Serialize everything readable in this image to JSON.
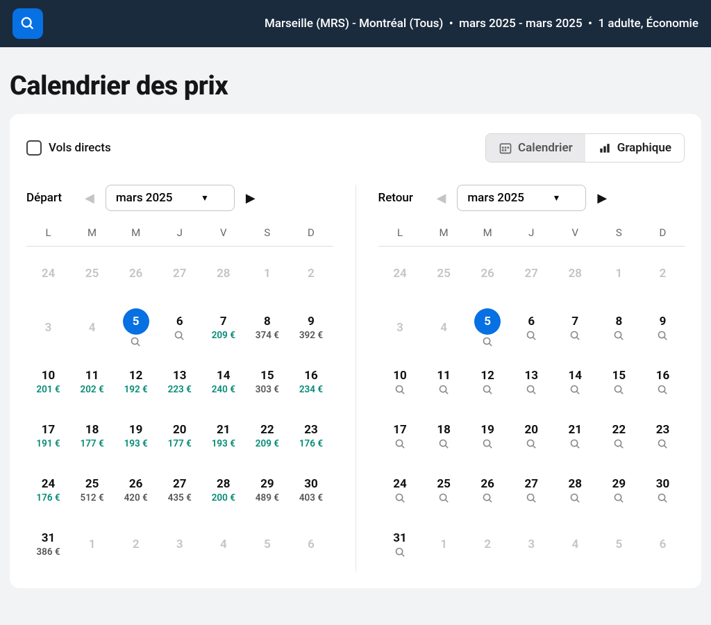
{
  "topbar": {
    "route": "Marseille (MRS) - Montréal (Tous)",
    "dates": "mars 2025 - mars 2025",
    "pax": "1 adulte, Économie"
  },
  "page_title": "Calendrier des prix",
  "direct_flights_label": "Vols directs",
  "view_toggle": {
    "calendar": "Calendrier",
    "chart": "Graphique"
  },
  "dow": [
    "L",
    "M",
    "M",
    "J",
    "V",
    "S",
    "D"
  ],
  "depart": {
    "label": "Départ",
    "month": "mars 2025",
    "cells": [
      {
        "d": "24",
        "dis": true
      },
      {
        "d": "25",
        "dis": true
      },
      {
        "d": "26",
        "dis": true
      },
      {
        "d": "27",
        "dis": true
      },
      {
        "d": "28",
        "dis": true
      },
      {
        "d": "1",
        "dis": true
      },
      {
        "d": "2",
        "dis": true
      },
      {
        "d": "3",
        "dis": true
      },
      {
        "d": "4",
        "dis": true
      },
      {
        "d": "5",
        "sel": true,
        "srch": true
      },
      {
        "d": "6",
        "srch": true
      },
      {
        "d": "7",
        "p": "209 €",
        "pl": true
      },
      {
        "d": "8",
        "p": "374 €"
      },
      {
        "d": "9",
        "p": "392 €"
      },
      {
        "d": "10",
        "p": "201 €",
        "pl": true
      },
      {
        "d": "11",
        "p": "202 €",
        "pl": true
      },
      {
        "d": "12",
        "p": "192 €",
        "pl": true
      },
      {
        "d": "13",
        "p": "223 €",
        "pl": true
      },
      {
        "d": "14",
        "p": "240 €",
        "pl": true
      },
      {
        "d": "15",
        "p": "303 €"
      },
      {
        "d": "16",
        "p": "234 €",
        "pl": true
      },
      {
        "d": "17",
        "p": "191 €",
        "pl": true
      },
      {
        "d": "18",
        "p": "177 €",
        "pl": true
      },
      {
        "d": "19",
        "p": "193 €",
        "pl": true
      },
      {
        "d": "20",
        "p": "177 €",
        "pl": true
      },
      {
        "d": "21",
        "p": "193 €",
        "pl": true
      },
      {
        "d": "22",
        "p": "209 €",
        "pl": true
      },
      {
        "d": "23",
        "p": "176 €",
        "pl": true
      },
      {
        "d": "24",
        "p": "176 €",
        "pl": true
      },
      {
        "d": "25",
        "p": "512 €"
      },
      {
        "d": "26",
        "p": "420 €"
      },
      {
        "d": "27",
        "p": "435 €"
      },
      {
        "d": "28",
        "p": "200 €",
        "pl": true
      },
      {
        "d": "29",
        "p": "489 €"
      },
      {
        "d": "30",
        "p": "403 €"
      },
      {
        "d": "31",
        "p": "386 €"
      },
      {
        "d": "1",
        "dis": true
      },
      {
        "d": "2",
        "dis": true
      },
      {
        "d": "3",
        "dis": true
      },
      {
        "d": "4",
        "dis": true
      },
      {
        "d": "5",
        "dis": true
      },
      {
        "d": "6",
        "dis": true
      }
    ]
  },
  "return": {
    "label": "Retour",
    "month": "mars 2025",
    "cells": [
      {
        "d": "24",
        "dis": true
      },
      {
        "d": "25",
        "dis": true
      },
      {
        "d": "26",
        "dis": true
      },
      {
        "d": "27",
        "dis": true
      },
      {
        "d": "28",
        "dis": true
      },
      {
        "d": "1",
        "dis": true
      },
      {
        "d": "2",
        "dis": true
      },
      {
        "d": "3",
        "dis": true
      },
      {
        "d": "4",
        "dis": true
      },
      {
        "d": "5",
        "sel": true,
        "srch": true
      },
      {
        "d": "6",
        "srch": true
      },
      {
        "d": "7",
        "srch": true
      },
      {
        "d": "8",
        "srch": true
      },
      {
        "d": "9",
        "srch": true
      },
      {
        "d": "10",
        "srch": true
      },
      {
        "d": "11",
        "srch": true
      },
      {
        "d": "12",
        "srch": true
      },
      {
        "d": "13",
        "srch": true
      },
      {
        "d": "14",
        "srch": true
      },
      {
        "d": "15",
        "srch": true
      },
      {
        "d": "16",
        "srch": true
      },
      {
        "d": "17",
        "srch": true
      },
      {
        "d": "18",
        "srch": true
      },
      {
        "d": "19",
        "srch": true
      },
      {
        "d": "20",
        "srch": true
      },
      {
        "d": "21",
        "srch": true
      },
      {
        "d": "22",
        "srch": true
      },
      {
        "d": "23",
        "srch": true
      },
      {
        "d": "24",
        "srch": true
      },
      {
        "d": "25",
        "srch": true
      },
      {
        "d": "26",
        "srch": true
      },
      {
        "d": "27",
        "srch": true
      },
      {
        "d": "28",
        "srch": true
      },
      {
        "d": "29",
        "srch": true
      },
      {
        "d": "30",
        "srch": true
      },
      {
        "d": "31",
        "srch": true
      },
      {
        "d": "1",
        "dis": true
      },
      {
        "d": "2",
        "dis": true
      },
      {
        "d": "3",
        "dis": true
      },
      {
        "d": "4",
        "dis": true
      },
      {
        "d": "5",
        "dis": true
      },
      {
        "d": "6",
        "dis": true
      }
    ]
  }
}
